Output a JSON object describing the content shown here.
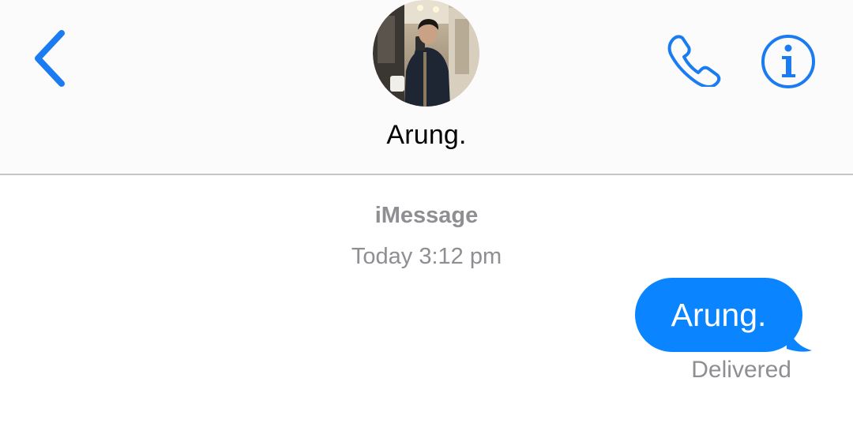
{
  "header": {
    "contact_name": "Arung.",
    "back_icon": "chevron-left-icon",
    "call_icon": "phone-icon",
    "info_icon": "info-icon",
    "accent_color": "#1a7cf0"
  },
  "conversation": {
    "service_label": "iMessage",
    "timestamp": "Today 3:12 pm",
    "messages": [
      {
        "direction": "outgoing",
        "text": "Arung.",
        "status": "Delivered",
        "bubble_color": "#0a84ff"
      }
    ]
  }
}
